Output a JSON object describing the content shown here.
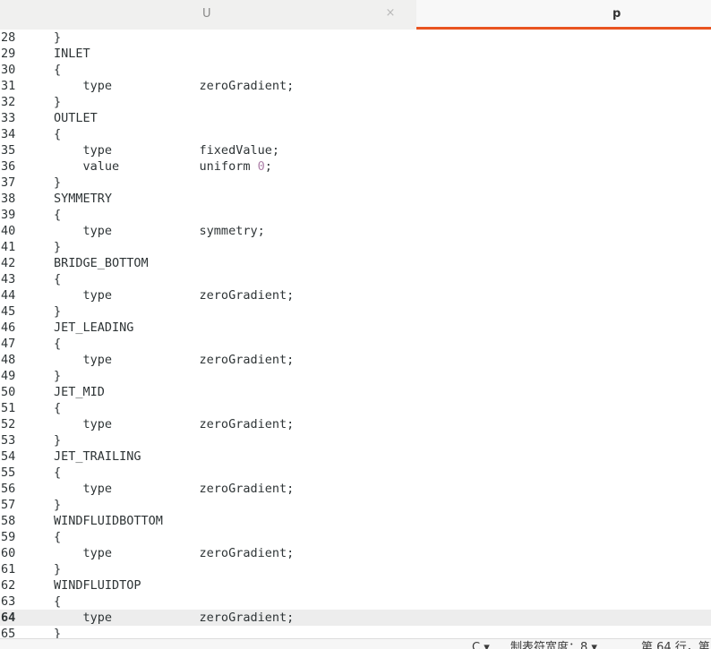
{
  "tabs": [
    {
      "label": "U",
      "active": false,
      "close_icon": "×"
    },
    {
      "label": "p",
      "active": true
    }
  ],
  "colors": {
    "accent": "#e95420",
    "current_line": "#ededed",
    "number_literal": "#ad7fa8"
  },
  "editor": {
    "current_line": 64,
    "lines": [
      {
        "n": "28",
        "text": "}"
      },
      {
        "n": "29",
        "text": "INLET"
      },
      {
        "n": "30",
        "text": "{"
      },
      {
        "n": "31",
        "text": "    type            zeroGradient;"
      },
      {
        "n": "32",
        "text": "}"
      },
      {
        "n": "33",
        "text": "OUTLET"
      },
      {
        "n": "34",
        "text": "{"
      },
      {
        "n": "35",
        "text": "    type            fixedValue;"
      },
      {
        "n": "36",
        "text": "    value           uniform ",
        "num": "0",
        "after": ";"
      },
      {
        "n": "37",
        "text": "}"
      },
      {
        "n": "38",
        "text": "SYMMETRY"
      },
      {
        "n": "39",
        "text": "{"
      },
      {
        "n": "40",
        "text": "    type            symmetry;"
      },
      {
        "n": "41",
        "text": "}"
      },
      {
        "n": "42",
        "text": "BRIDGE_BOTTOM"
      },
      {
        "n": "43",
        "text": "{"
      },
      {
        "n": "44",
        "text": "    type            zeroGradient;"
      },
      {
        "n": "45",
        "text": "}"
      },
      {
        "n": "46",
        "text": "JET_LEADING"
      },
      {
        "n": "47",
        "text": "{"
      },
      {
        "n": "48",
        "text": "    type            zeroGradient;"
      },
      {
        "n": "49",
        "text": "}"
      },
      {
        "n": "50",
        "text": "JET_MID"
      },
      {
        "n": "51",
        "text": "{"
      },
      {
        "n": "52",
        "text": "    type            zeroGradient;"
      },
      {
        "n": "53",
        "text": "}"
      },
      {
        "n": "54",
        "text": "JET_TRAILING"
      },
      {
        "n": "55",
        "text": "{"
      },
      {
        "n": "56",
        "text": "    type            zeroGradient;"
      },
      {
        "n": "57",
        "text": "}"
      },
      {
        "n": "58",
        "text": "WINDFLUIDBOTTOM"
      },
      {
        "n": "59",
        "text": "{"
      },
      {
        "n": "60",
        "text": "    type            zeroGradient;"
      },
      {
        "n": "61",
        "text": "}"
      },
      {
        "n": "62",
        "text": "WINDFLUIDTOP"
      },
      {
        "n": "63",
        "text": "{"
      },
      {
        "n": "64",
        "text": "    type            zeroGradient;"
      },
      {
        "n": "65",
        "text": "}"
      }
    ]
  },
  "statusbar": {
    "language": "C ▾",
    "tab_width": "制表符宽度：8 ▾",
    "cursor_position": "第 64 行，第"
  }
}
